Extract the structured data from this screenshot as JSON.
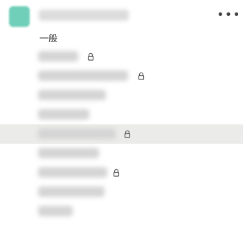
{
  "header": {
    "workspace_name": "",
    "more_glyph": "•••"
  },
  "section": {
    "title": "一般"
  },
  "channels": [
    {
      "name": "",
      "locked": true,
      "selected": false
    },
    {
      "name": "",
      "locked": true,
      "selected": false
    },
    {
      "name": "",
      "locked": false,
      "selected": false
    },
    {
      "name": "",
      "locked": false,
      "selected": false
    },
    {
      "name": "",
      "locked": true,
      "selected": true
    },
    {
      "name": "",
      "locked": false,
      "selected": false
    },
    {
      "name": "",
      "locked": true,
      "selected": false
    },
    {
      "name": "",
      "locked": false,
      "selected": false
    },
    {
      "name": "",
      "locked": false,
      "selected": false
    }
  ],
  "icons": {
    "lock": "lock-icon",
    "more": "more-icon",
    "workspace": "workspace-icon"
  },
  "colors": {
    "workspace_icon": "#6fcfb8",
    "selected_row": "#ebebe9"
  }
}
